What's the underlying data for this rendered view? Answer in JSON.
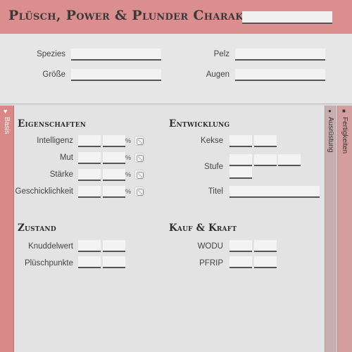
{
  "title": {
    "text": "Plüsch, Power & Plunder Charakter von",
    "name_value": ""
  },
  "basics": {
    "spezies_label": "Spezies",
    "groesse_label": "Größe",
    "pelz_label": "Pelz",
    "augen_label": "Augen"
  },
  "tabs": {
    "left_label": "Basis",
    "right_a_label": "Ausrüstung",
    "right_b_label": "Fertigkeiten"
  },
  "eigenschaften": {
    "heading": "Eigenschaften",
    "percent_sign": "%",
    "rows": [
      {
        "label": "Intelligenz"
      },
      {
        "label": "Mut"
      },
      {
        "label": "Stärke"
      },
      {
        "label": "Geschicklichkeit"
      }
    ]
  },
  "entwicklung": {
    "heading": "Entwicklung",
    "kekse_label": "Kekse",
    "stufe_label": "Stufe",
    "titel_label": "Titel"
  },
  "zustand": {
    "heading": "Zustand",
    "knuddelwert_label": "Knuddelwert",
    "pluschpunkte_label": "Plüschpunkte"
  },
  "kauf_kraft": {
    "heading": "Kauf & Kraft",
    "wodu_label": "WODU",
    "pfrip_label": "PFRIP"
  },
  "colors": {
    "header": "#db8e8e",
    "left_tab": "#d98888",
    "right_tab_a": "#c7aeae",
    "right_tab_b": "#d59e9e"
  }
}
